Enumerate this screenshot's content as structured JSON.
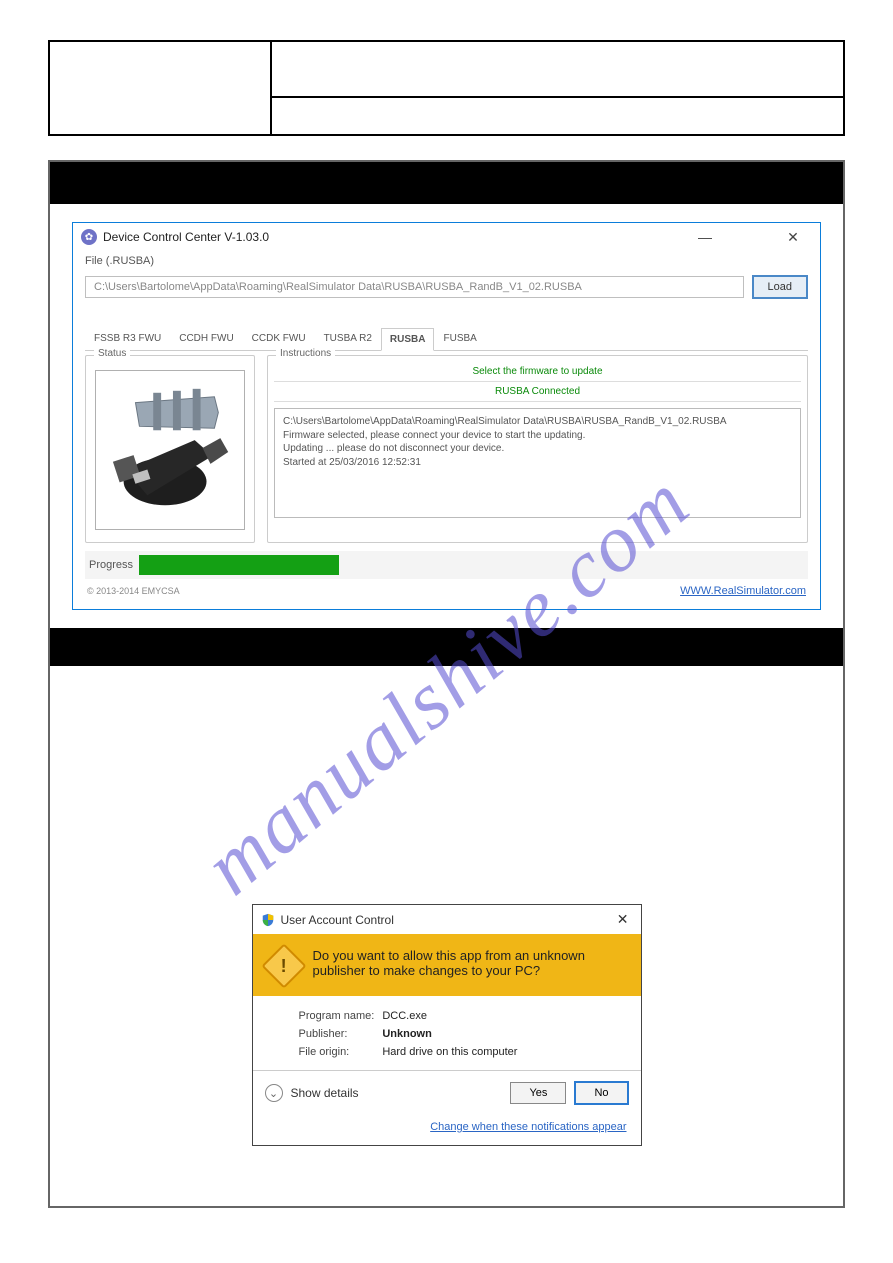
{
  "win": {
    "title": "Device Control Center V-1.03.0",
    "file_label": "File (.RUSBA)",
    "path": "C:\\Users\\Bartolome\\AppData\\Roaming\\RealSimulator Data\\RUSBA\\RUSBA_RandB_V1_02.RUSBA",
    "load_btn": "Load",
    "tabs": [
      "FSSB R3 FWU",
      "CCDH FWU",
      "CCDK FWU",
      "TUSBA R2",
      "RUSBA",
      "FUSBA"
    ],
    "active_tab": "RUSBA",
    "status_label": "Status",
    "instructions_label": "Instructions",
    "instr1": "Select the firmware to update",
    "instr2": "RUSBA Connected",
    "log_line1": "C:\\Users\\Bartolome\\AppData\\Roaming\\RealSimulator Data\\RUSBA\\RUSBA_RandB_V1_02.RUSBA",
    "log_line2": "Firmware selected, please connect your device to start the updating.",
    "log_line3": "Updating ... please do not disconnect your device.",
    "log_line4": "Started at 25/03/2016 12:52:31",
    "progress_label": "Progress",
    "copyright": "© 2013-2014 EMYCSA",
    "site_link": "WWW.RealSimulator.com"
  },
  "watermark": "manualshive.com",
  "uac": {
    "title": "User Account Control",
    "question": "Do you want to allow this app from an unknown publisher to make changes to your PC?",
    "labels": {
      "program": "Program name:",
      "publisher": "Publisher:",
      "origin": "File origin:"
    },
    "program": "DCC.exe",
    "publisher": "Unknown",
    "origin": "Hard drive on this computer",
    "show_details": "Show details",
    "yes": "Yes",
    "no": "No",
    "change_link": "Change when these notifications appear"
  }
}
